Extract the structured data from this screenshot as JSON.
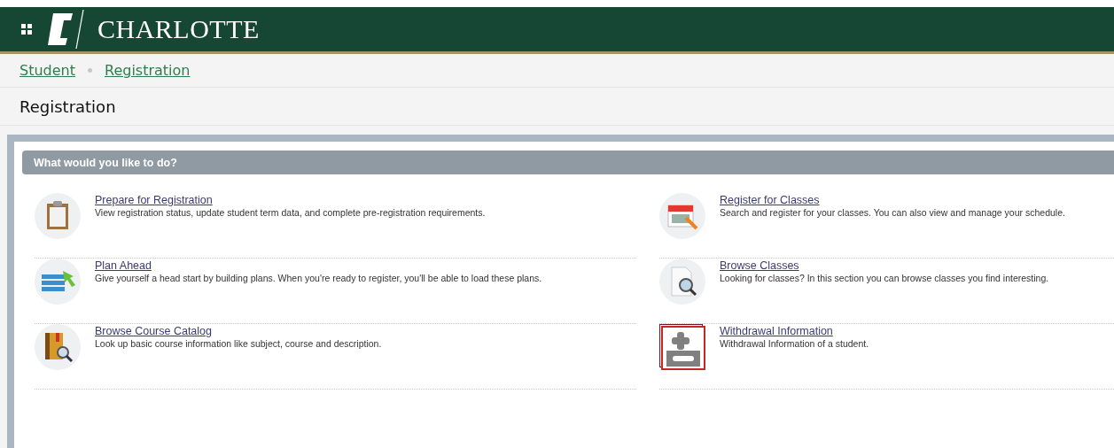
{
  "header": {
    "logo_text": "CHARLOTTE"
  },
  "breadcrumbs": [
    "Student",
    "Registration"
  ],
  "page_title": "Registration",
  "panel": {
    "title": "What would you like to do?",
    "items": [
      {
        "title": "Prepare for Registration",
        "description": "View registration status, update student term data, and complete pre-registration requirements."
      },
      {
        "title": "Register for Classes",
        "description": "Search and register for your classes. You can also view and manage your schedule."
      },
      {
        "title": "Plan Ahead",
        "description": "Give yourself a head start by building plans. When you're ready to register, you'll be able to load these plans."
      },
      {
        "title": "Browse Classes",
        "description": "Looking for classes? In this section you can browse classes you find interesting."
      },
      {
        "title": "Browse Course Catalog",
        "description": "Look up basic course information like subject, course and description."
      },
      {
        "title": "Withdrawal Information",
        "description": "Withdrawal Information of a student."
      }
    ]
  }
}
